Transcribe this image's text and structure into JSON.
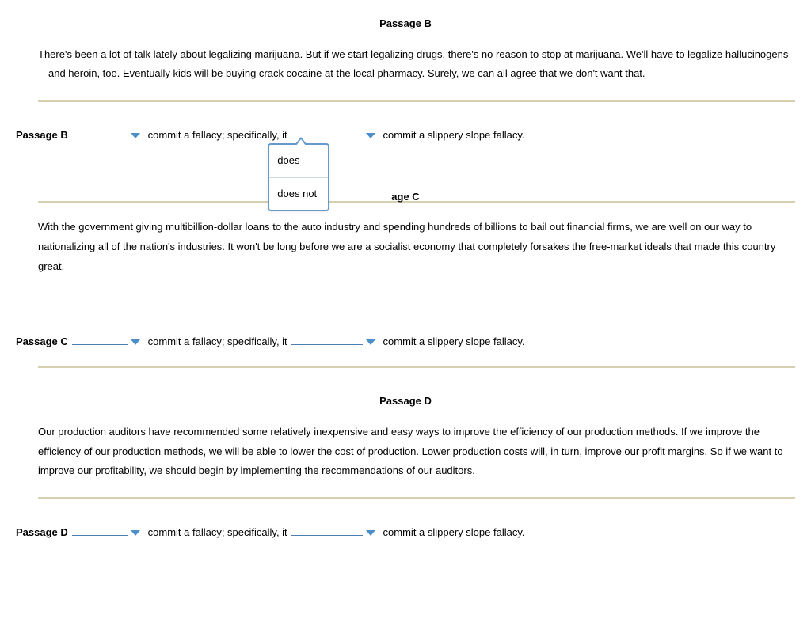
{
  "passages": {
    "b": {
      "title": "Passage B",
      "text": "There's been a lot of talk lately about legalizing marijuana. But if we start legalizing drugs, there's no reason to stop at marijuana. We'll have to legalize hallucinogens—and heroin, too. Eventually kids will be buying crack cocaine at the local pharmacy. Surely, we can all agree that we don't want that."
    },
    "c": {
      "title": "Passage C",
      "title_occluded": "age C",
      "text": "With the government giving multibillion-dollar loans to the auto industry and spending hundreds of billions to bail out financial firms, we are well on our way to nationalizing all of the nation's industries. It won't be long before we are a socialist economy that completely forsakes the free-market ideals that made this country great."
    },
    "d": {
      "title": "Passage D",
      "text": "Our production auditors have recommended some relatively inexpensive and easy ways to improve the efficiency of our production methods. If we improve the efficiency of our production methods, we will be able to lower the cost of production. Lower production costs will, in turn, improve our profit margins. So if we want to improve our profitability, we should begin by implementing the recommendations of our auditors."
    }
  },
  "question": {
    "label_b": "Passage B",
    "label_c": "Passage C",
    "label_d": "Passage D",
    "mid": "commit a fallacy; specifically, it",
    "tail": "commit a slippery slope fallacy."
  },
  "dropdown": {
    "opt1": "does",
    "opt2": "does not"
  }
}
